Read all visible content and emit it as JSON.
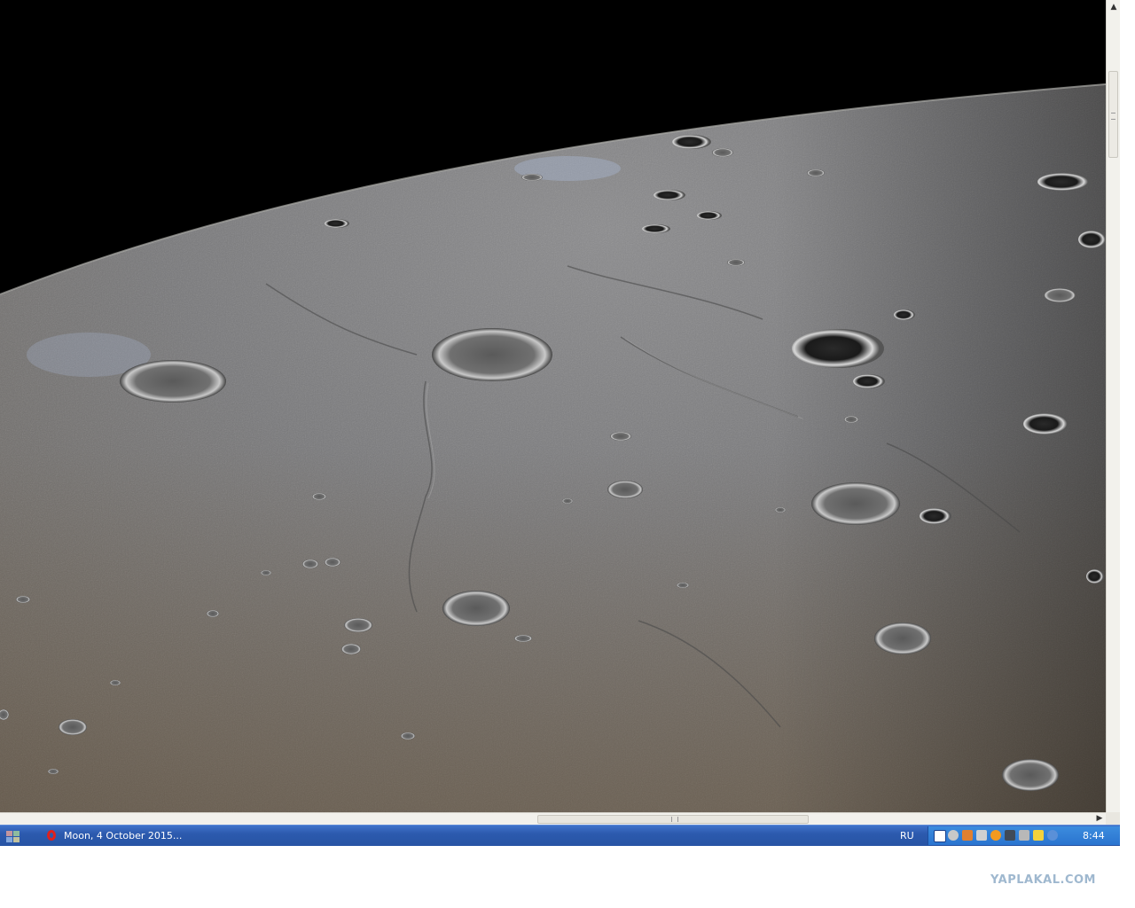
{
  "viewer": {
    "image_subject": "lunar-surface-photo"
  },
  "taskbar": {
    "start_icon": "windows-flag-icon",
    "active_task": {
      "icon": "opera-icon",
      "label": "Moon, 4 October 2015..."
    },
    "language": "RU",
    "tray_icons": [
      "help-icon",
      "network-icon",
      "volume-icon",
      "sync-icon",
      "browser-icon",
      "monitor-icon",
      "window-icon",
      "tool-icon",
      "security-icon"
    ],
    "clock": "8:44"
  },
  "watermark": {
    "text": "YAPLAKAL.COM"
  },
  "colors": {
    "taskbar": "#2c5aae",
    "tray": "#2a74cf",
    "scrollbar": "#f2f1ec",
    "watermark": "#9fb8cf"
  }
}
